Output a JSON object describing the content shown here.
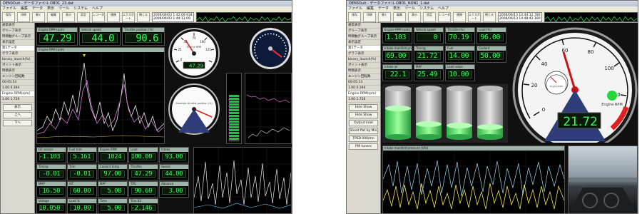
{
  "left": {
    "title": "DENSOuit - データファイル OBD1_23.dat",
    "menu": [
      "ファイル",
      "編集",
      "データ",
      "表示",
      "ツール",
      "システム",
      "ヘルプ"
    ],
    "toolbar_labels": [
      "保存",
      "印刷",
      "開く",
      "編集",
      "表示",
      "設定",
      "レコーダ",
      "連携",
      "エクスポート",
      "閉じる"
    ],
    "info_lines": [
      "2006/06/03 1:42:09.934",
      "2006/06/03 1:44:12.09"
    ],
    "sidebar": {
      "rows": [
        "通常表示",
        "グループ表示",
        "時間軸グループ表示",
        "表示設定",
        "第1データ",
        "グラフ表示",
        "binary_launch(%)",
        "ポイント表示",
        "時間表示",
        "エンジン回転数",
        "00:05:54",
        "1.00 0.394",
        "Engine RPM(rpm)",
        "1.00 1.726"
      ],
      "buttons": [
        "表示",
        "上へ",
        "下へ"
      ]
    },
    "lcd": [
      {
        "label": "Engine RPM (rpm)",
        "value": "47.29"
      },
      {
        "label": "Vehicle speed",
        "value": "44.0"
      },
      {
        "label": "Throttle position (%)",
        "value": "90.6"
      },
      {
        "label": "O2 sensor",
        "value": "-1.103"
      },
      {
        "label": "Fuel trim",
        "value": "5.161"
      },
      {
        "label": "Engine RPM",
        "value": "1024"
      },
      {
        "label": "Load",
        "value": "100.00"
      },
      {
        "label": "Intake",
        "value": "93.00"
      },
      {
        "label": "Timing",
        "value": "-0.01"
      },
      {
        "label": "Trim",
        "value": "-0.01"
      },
      {
        "label": "Coolant temp",
        "value": "97.00"
      },
      {
        "label": "Throttle",
        "value": "47.29"
      },
      {
        "label": "Speed",
        "value": "44.00"
      },
      {
        "label": "MAP",
        "value": "16.50"
      },
      {
        "label": "IAT",
        "value": "60.00"
      },
      {
        "label": "MAF",
        "value": "5.08"
      },
      {
        "label": "TPS",
        "value": "90.60"
      },
      {
        "label": "Advance",
        "value": "3.00"
      },
      {
        "label": "Voltage",
        "value": "10.050"
      },
      {
        "label": "Load %",
        "value": "10.00"
      },
      {
        "label": "Time",
        "value": "5.00"
      },
      {
        "label": "Trim B2",
        "value": "-2.146"
      }
    ],
    "chart_title": "Engine RPM (rpm)",
    "gauge1": {
      "label": "Engine RPM",
      "readout": "47.29",
      "ticks": [
        "0",
        "25",
        "50",
        "75",
        "100",
        "125"
      ]
    },
    "gauge2": {
      "label": "Absolute throttle position (%)"
    }
  },
  "right": {
    "title": "DENSOuit - データファイル OBD1_NON1_1.dat",
    "menu": [
      "ファイル",
      "編集",
      "データ",
      "表示",
      "ツール",
      "システム",
      "ヘルプ"
    ],
    "toolbar_labels": [
      "保存",
      "印刷",
      "開く",
      "編集",
      "表示",
      "設定",
      "レコーダ",
      "連携",
      "エクスポート",
      "閉じる"
    ],
    "info_lines": [
      "2006/06/13 14:44:12.780",
      "2006/06/13 14:48:42.180"
    ],
    "sidebar": {
      "rows": [
        "通常表示",
        "グループ表示",
        "時間軸グループ表示",
        "表示設定",
        "第1データ",
        "グラフ表示",
        "binary_launch(%)",
        "ポイント表示",
        "時間表示",
        "エンジン回転数",
        "00:05:13",
        "1.00 0.394",
        "Engine RPM(rpm)",
        "1.00 1.726"
      ],
      "buttons": [
        "Hide Show",
        "Hide Show",
        "Output Inlet",
        "Shoot flat by Mix",
        "TPSD 000/mn",
        "PW tuners"
      ]
    },
    "lcd": [
      {
        "label": "Engine RPM (rpm)",
        "value": "-1.103"
      },
      {
        "label": "Vehicle speed",
        "value": "0"
      },
      {
        "label": "Throttle (%)",
        "value": "70.19"
      },
      {
        "label": "Load (%)",
        "value": "96.00"
      },
      {
        "label": "Intake manifold pressure",
        "value": "69.00"
      },
      {
        "label": "Timing",
        "value": "21.72"
      },
      {
        "label": "Fuel",
        "value": "14.00"
      },
      {
        "label": "Coolant",
        "value": "50.00"
      },
      {
        "label": "Intake air",
        "value": "22.1"
      },
      {
        "label": "MAF",
        "value": "25.49"
      },
      {
        "label": "Load value",
        "value": "10.00"
      }
    ],
    "big_gauge": {
      "label": "Engine RPM",
      "readout": "21.72",
      "ticks": [
        "0",
        "20",
        "40",
        "60",
        "80",
        "100",
        "120"
      ]
    },
    "small_gauge": {
      "label": "Engine RPM"
    },
    "chart_title": "Intake manifold pressure (kPa)"
  }
}
